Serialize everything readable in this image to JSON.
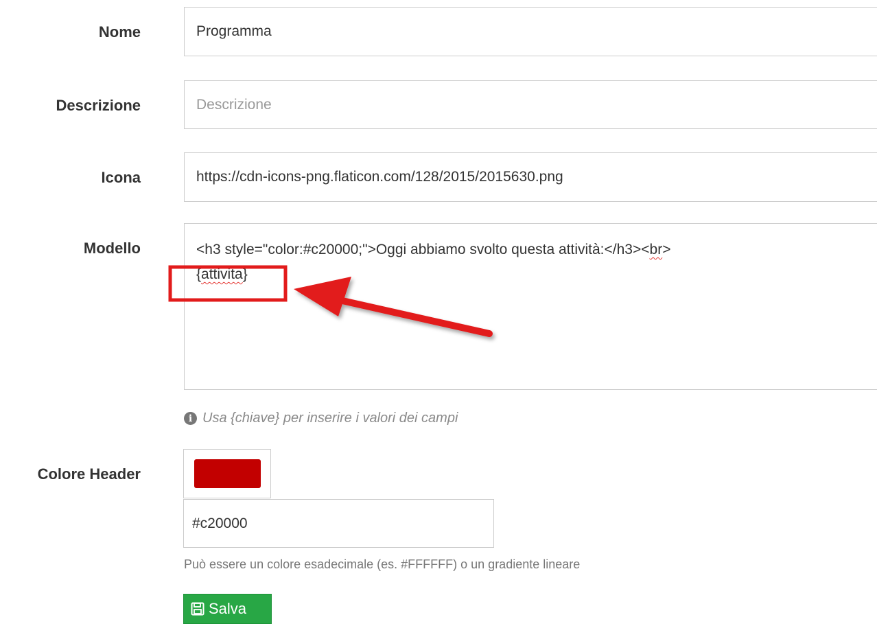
{
  "form": {
    "nome": {
      "label": "Nome",
      "value": "Programma"
    },
    "descrizione": {
      "label": "Descrizione",
      "placeholder": "Descrizione"
    },
    "icona": {
      "label": "Icona",
      "value": "https://cdn-icons-png.flaticon.com/128/2015/2015630.png"
    },
    "modello": {
      "label": "Modello",
      "line1_prefix": "<h3 style=\"color:#c20000;\">Oggi abbiamo svolto questa attività:</h3><",
      "line1_squiggle": "br",
      "line1_suffix": ">",
      "line2_prefix": "{",
      "line2_squiggle": "attivita",
      "line2_suffix": "}",
      "help_icon": "info-icon",
      "help_text": "Usa {chiave} per inserire i valori dei campi"
    },
    "colore_header": {
      "label": "Colore Header",
      "swatch_color": "#c20000",
      "value": "#c20000",
      "help_text": "Può essere un colore esadecimale (es. #FFFFFF) o un gradiente lineare"
    },
    "save_button": {
      "label": "Salva",
      "icon": "floppy-disk-icon",
      "color": "#28a745"
    }
  },
  "annotation": {
    "highlight_color": "#e21b1b",
    "arrow_color": "#e21b1b"
  }
}
